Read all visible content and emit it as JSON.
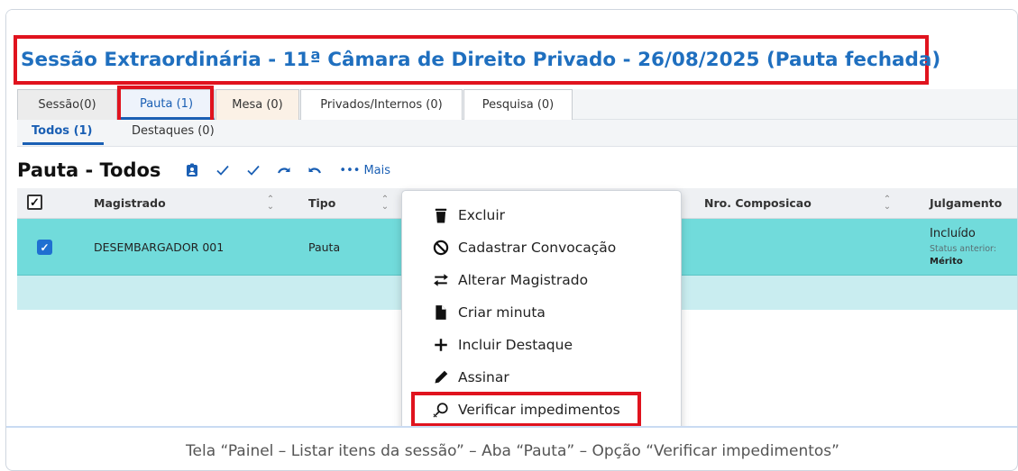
{
  "page": {
    "title": "Sessão Extraordinária - 11ª Câmara de Direito Privado - 26/08/2025 (Pauta fechada)",
    "caption": "Tela “Painel – Listar itens da sessão” – Aba “Pauta” – Opção “Verificar impedimentos”"
  },
  "tabs": [
    {
      "label": "Sessão(0)"
    },
    {
      "label": "Pauta (1)",
      "active": true
    },
    {
      "label": "Mesa (0)"
    },
    {
      "label": "Privados/Internos (0)"
    },
    {
      "label": "Pesquisa (0)"
    }
  ],
  "subtabs": [
    {
      "label": "Todos (1)",
      "active": true
    },
    {
      "label": "Destaques (0)"
    }
  ],
  "toolbar": {
    "title": "Pauta - Todos",
    "more_label": "Mais"
  },
  "grid": {
    "columns": [
      "Magistrado",
      "Tipo",
      "Nro. Composicao",
      "Julgamento"
    ],
    "rows": [
      {
        "selected": true,
        "magistrado": "DESEMBARGADOR 001",
        "tipo": "Pauta",
        "nro_composicao": "",
        "julgamento": "Incluído",
        "status_anterior_label": "Status anterior:",
        "status_anterior": "Mérito"
      }
    ]
  },
  "context_menu": {
    "items": [
      {
        "label": "Excluir",
        "icon": "trash-icon"
      },
      {
        "label": "Cadastrar Convocação",
        "icon": "ban-icon"
      },
      {
        "label": "Alterar Magistrado",
        "icon": "swap-arrows-icon"
      },
      {
        "label": "Criar minuta",
        "icon": "file-icon"
      },
      {
        "label": "Incluir Destaque",
        "icon": "plus-icon"
      },
      {
        "label": "Assinar",
        "icon": "pen-icon"
      },
      {
        "label": "Verificar impedimentos",
        "icon": "search-x-icon",
        "highlighted": true
      }
    ]
  },
  "colors": {
    "title_blue": "#1f6fbf",
    "accent_blue": "#1a5fb4",
    "highlight_red": "#e0131e",
    "selected_row": "#71dbdb"
  }
}
